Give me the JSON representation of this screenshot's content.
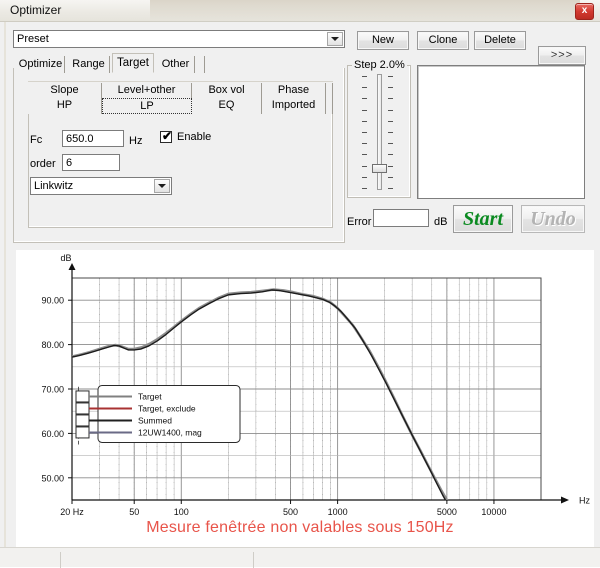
{
  "window": {
    "title": "Optimizer",
    "close_icon": "close-icon",
    "close_label": "x"
  },
  "preset": {
    "value": "Preset",
    "placeholder": "Preset",
    "dropdown_icon": "chevron-down-icon"
  },
  "toolbar": {
    "new_label": "New",
    "clone_label": "Clone",
    "delete_label": "Delete",
    "more_label": ">>>"
  },
  "tabs": {
    "main": [
      {
        "label": "Optimize",
        "selected": false
      },
      {
        "label": "Range",
        "selected": false
      },
      {
        "label": "Target",
        "selected": true
      },
      {
        "label": "Other",
        "selected": false
      }
    ],
    "sub_row1": [
      {
        "label": "Slope",
        "selected": false
      },
      {
        "label": "Level+other",
        "selected": false
      },
      {
        "label": "Box vol",
        "selected": false
      },
      {
        "label": "Phase",
        "selected": false
      }
    ],
    "sub_row2": [
      {
        "label": "HP",
        "selected": false
      },
      {
        "label": "LP",
        "selected": true
      },
      {
        "label": "EQ",
        "selected": false
      },
      {
        "label": "Imported",
        "selected": false
      }
    ]
  },
  "target_form": {
    "fc_label": "Fc",
    "fc_value": "650.0",
    "fc_unit": "Hz",
    "order_label": "order",
    "order_value": "6",
    "enable_label": "Enable",
    "enable_checked": true,
    "enable_tick": "✔",
    "filter_type": "Linkwitz",
    "filter_dropdown_icon": "chevron-down-icon"
  },
  "step": {
    "group_title": "Step 2.0%",
    "slider_position_percent": 22
  },
  "run": {
    "error_label": "Error",
    "error_value": "",
    "error_unit": "dB",
    "start_label": "Start",
    "undo_label": "Undo",
    "start_color": "#0a8a20",
    "undo_disabled": true
  },
  "log": {
    "content": ""
  },
  "warning": {
    "text": "Mesure fenêtrée non valables sous 150Hz",
    "color": "#e8544a"
  },
  "chart_data": {
    "type": "line",
    "title": "",
    "xlabel": "Hz",
    "ylabel": "dB",
    "xscale": "log",
    "xlim": [
      20,
      20000
    ],
    "ylim": [
      45,
      95
    ],
    "grid": true,
    "legend_position": "inside-left",
    "xticks": [
      {
        "value": 20,
        "label": "20 Hz"
      },
      {
        "value": 50,
        "label": "50"
      },
      {
        "value": 100,
        "label": "100"
      },
      {
        "value": 500,
        "label": "500"
      },
      {
        "value": 1000,
        "label": "1000"
      },
      {
        "value": 5000,
        "label": "5000"
      },
      {
        "value": 10000,
        "label": "10000"
      }
    ],
    "yticks": [
      {
        "value": 90,
        "label": "90.00"
      },
      {
        "value": 80,
        "label": "80.00"
      },
      {
        "value": 70,
        "label": "70.00"
      },
      {
        "value": 60,
        "label": "60.00"
      },
      {
        "value": 50,
        "label": "50.00"
      }
    ],
    "legend": [
      {
        "label": "Target",
        "color": "#808080",
        "checked": false
      },
      {
        "label": "Target, exclude",
        "color": "#a83232",
        "checked": false
      },
      {
        "label": "Summed",
        "color": "#202020",
        "checked": false
      },
      {
        "label": "12UW1400, mag",
        "color": "#6a6a86",
        "checked": false
      }
    ],
    "series": [
      {
        "name": "Target",
        "color": "#8c8c8c",
        "width": 2.6,
        "points": [
          [
            20,
            77.3
          ],
          [
            23,
            77.8
          ],
          [
            26,
            78.3
          ],
          [
            30,
            79.0
          ],
          [
            34,
            79.6
          ],
          [
            38,
            79.9
          ],
          [
            42,
            79.5
          ],
          [
            46,
            79.0
          ],
          [
            50,
            79.0
          ],
          [
            56,
            79.4
          ],
          [
            63,
            80.2
          ],
          [
            71,
            81.3
          ],
          [
            80,
            82.6
          ],
          [
            90,
            84.0
          ],
          [
            100,
            85.3
          ],
          [
            115,
            86.9
          ],
          [
            130,
            88.2
          ],
          [
            150,
            89.4
          ],
          [
            175,
            90.6
          ],
          [
            200,
            91.4
          ],
          [
            240,
            91.7
          ],
          [
            280,
            91.8
          ],
          [
            330,
            92.1
          ],
          [
            390,
            92.4
          ],
          [
            450,
            92.2
          ],
          [
            520,
            91.8
          ],
          [
            600,
            91.3
          ],
          [
            700,
            90.9
          ],
          [
            800,
            90.3
          ],
          [
            900,
            89.5
          ],
          [
            1000,
            88.2
          ],
          [
            1100,
            86.6
          ],
          [
            1250,
            84.4
          ],
          [
            1400,
            81.8
          ],
          [
            1600,
            78.6
          ],
          [
            1800,
            75.3
          ],
          [
            2000,
            72.2
          ],
          [
            2300,
            67.9
          ],
          [
            2600,
            64.0
          ],
          [
            3000,
            59.6
          ],
          [
            3400,
            56.0
          ],
          [
            3800,
            52.7
          ],
          [
            4200,
            49.8
          ],
          [
            4600,
            47.2
          ],
          [
            5000,
            45.0
          ]
        ]
      },
      {
        "name": "Summed",
        "color": "#1c1c1c",
        "width": 1.4,
        "points": [
          [
            20,
            77.2
          ],
          [
            22,
            77.5
          ],
          [
            25,
            78.0
          ],
          [
            28,
            78.5
          ],
          [
            31,
            79.0
          ],
          [
            34,
            79.4
          ],
          [
            37,
            79.8
          ],
          [
            40,
            79.7
          ],
          [
            43,
            79.2
          ],
          [
            46,
            78.8
          ],
          [
            50,
            78.8
          ],
          [
            55,
            79.0
          ],
          [
            62,
            79.7
          ],
          [
            70,
            80.8
          ],
          [
            80,
            82.3
          ],
          [
            90,
            83.8
          ],
          [
            100,
            85.1
          ],
          [
            115,
            86.7
          ],
          [
            130,
            88.0
          ],
          [
            150,
            89.2
          ],
          [
            175,
            90.4
          ],
          [
            200,
            91.2
          ],
          [
            240,
            91.5
          ],
          [
            280,
            91.6
          ],
          [
            330,
            91.9
          ],
          [
            380,
            92.3
          ],
          [
            420,
            92.2
          ],
          [
            470,
            91.9
          ],
          [
            520,
            91.6
          ],
          [
            580,
            91.3
          ],
          [
            650,
            91.0
          ],
          [
            720,
            90.6
          ],
          [
            800,
            90.2
          ],
          [
            880,
            89.6
          ],
          [
            960,
            88.7
          ],
          [
            1050,
            87.5
          ],
          [
            1150,
            85.9
          ],
          [
            1300,
            83.6
          ],
          [
            1450,
            80.9
          ],
          [
            1650,
            77.5
          ],
          [
            1850,
            74.2
          ],
          [
            2050,
            71.2
          ],
          [
            2350,
            67.0
          ],
          [
            2700,
            62.8
          ],
          [
            3100,
            58.6
          ],
          [
            3500,
            55.0
          ],
          [
            3900,
            51.8
          ],
          [
            4300,
            48.8
          ],
          [
            4700,
            46.1
          ],
          [
            5000,
            44.4
          ]
        ]
      }
    ]
  }
}
